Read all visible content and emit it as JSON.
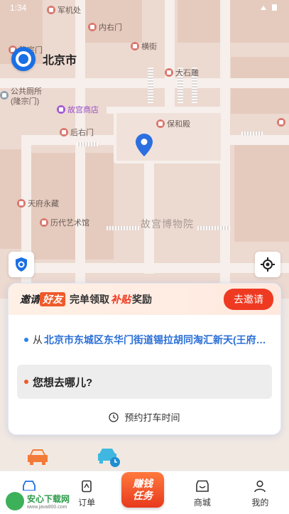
{
  "status_bar": {
    "time": "1:34"
  },
  "city": {
    "name": "北京市"
  },
  "map": {
    "park_label": "故宫博物院",
    "pois": [
      {
        "name": "军机处",
        "kind": "red"
      },
      {
        "name": "内右门",
        "kind": "red"
      },
      {
        "name": "隆宗门",
        "kind": "red"
      },
      {
        "name": "横街",
        "kind": "red"
      },
      {
        "name": "大石雕",
        "kind": "red"
      },
      {
        "name": "公共厕所\n(隆宗门)",
        "kind": "gray"
      },
      {
        "name": "故宫商店",
        "kind": "purple"
      },
      {
        "name": "后右门",
        "kind": "red"
      },
      {
        "name": "保和殿",
        "kind": "red"
      },
      {
        "name": "天府永藏",
        "kind": "red"
      },
      {
        "name": "历代艺术馆",
        "kind": "red"
      }
    ]
  },
  "invite": {
    "part1": "邀请",
    "part2": "好友",
    "part3": "完单领取",
    "part4": "补贴",
    "part5": "奖励",
    "button": "去邀请"
  },
  "trip": {
    "from_prefix": "从",
    "from_address": "北京市东城区东华门街道锡拉胡同淘汇新天(王府…",
    "destination_placeholder": "您想去哪儿?",
    "reserve_label": "预约打车时间"
  },
  "nav": {
    "order": "订单",
    "task": "赚钱\n任务",
    "mall": "商城",
    "mine": "我的"
  },
  "watermark": {
    "title": "安心下载网",
    "url": "www.java800.com"
  },
  "colors": {
    "brand_blue": "#1b6fe4",
    "accent_red": "#ef3a22",
    "pin_blue": "#2c6fe0"
  }
}
